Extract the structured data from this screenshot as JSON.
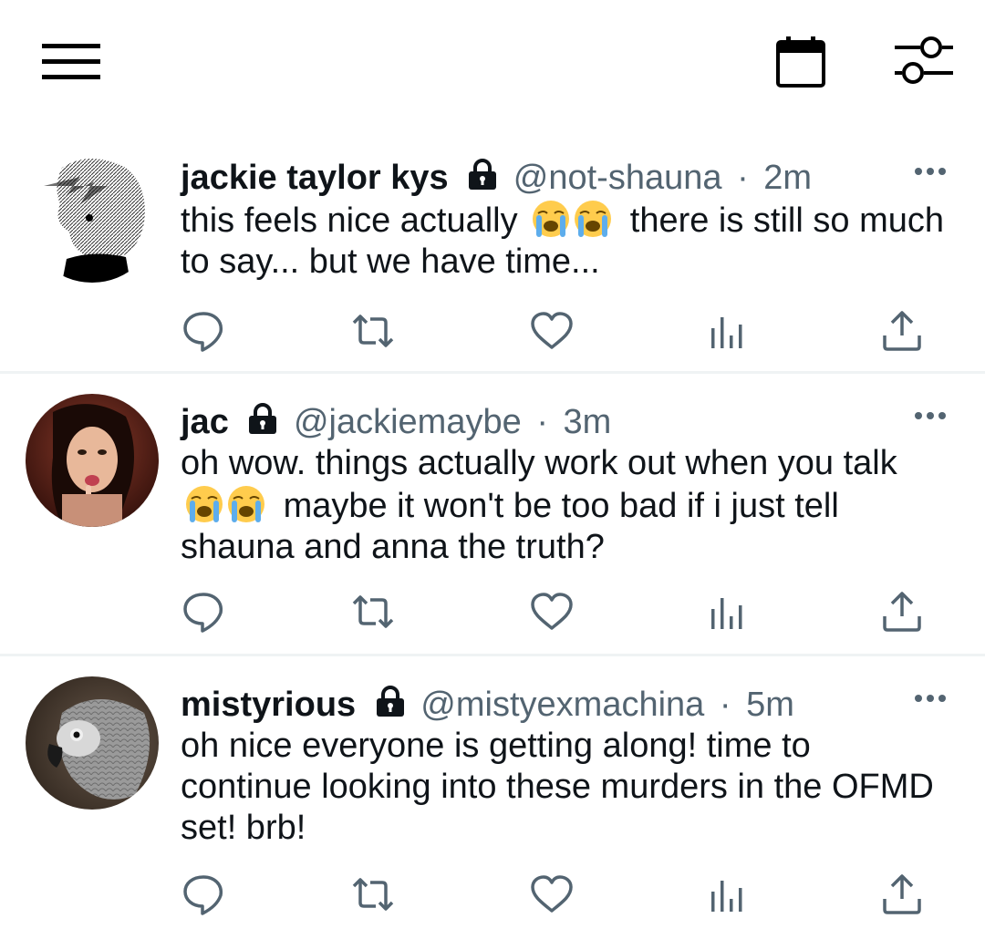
{
  "topbar": {
    "menu_icon": "hamburger-menu-icon",
    "calendar_icon": "calendar-icon",
    "filter_icon": "filter-sliders-icon"
  },
  "tweets": [
    {
      "display_name": "jackie taylor kys",
      "handle": "@not-shauna",
      "separator": "·",
      "time": "2m",
      "text_before_emoji": "this feels nice actually",
      "emoji": "😭😭",
      "text_after_emoji": "there is still so much to say... but we have time..."
    },
    {
      "display_name": "jac",
      "handle": "@jackiemaybe",
      "separator": "·",
      "time": "3m",
      "text_before_emoji": "oh wow. things actually work out when you talk",
      "emoji": "😭😭",
      "text_after_emoji": "maybe it won't be too bad if i just tell shauna and anna the truth?"
    },
    {
      "display_name": "mistyrious",
      "handle": "@mistyexmachina",
      "separator": "·",
      "time": "5m",
      "text_before_emoji": "oh nice everyone is getting along! time to continue looking into these murders in the OFMD set! brb!",
      "emoji": "",
      "text_after_emoji": ""
    }
  ],
  "colors": {
    "text": "#0f1419",
    "secondary": "#536471",
    "divider": "#eff3f4"
  }
}
